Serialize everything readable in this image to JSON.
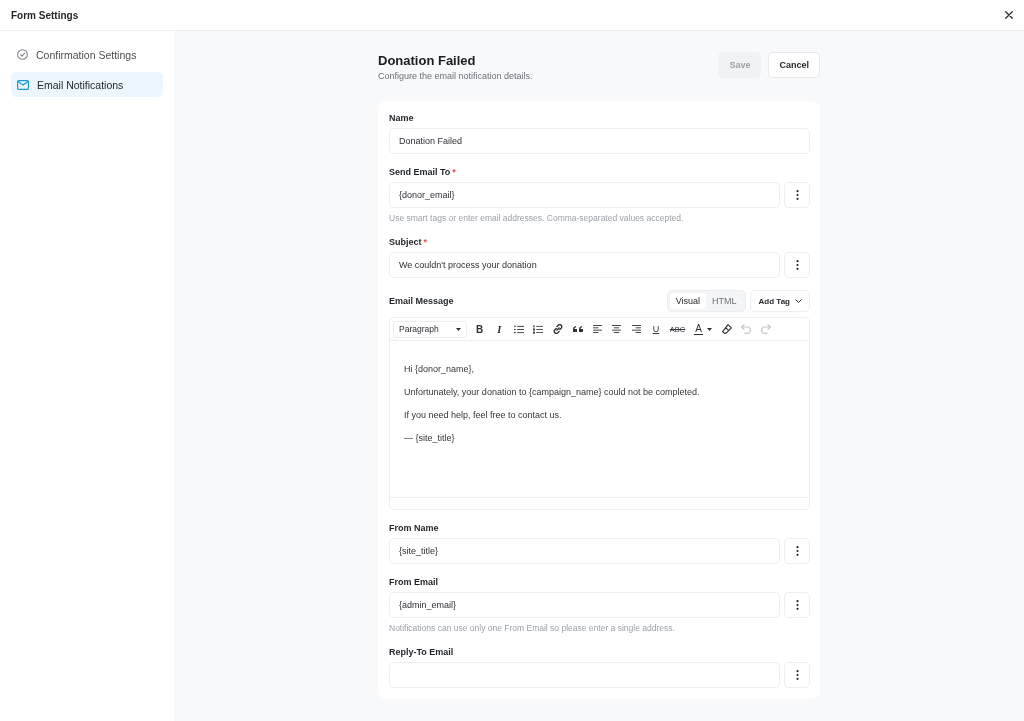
{
  "window": {
    "title": "Form Settings"
  },
  "sidebar": {
    "items": [
      {
        "kind": "check",
        "label": "Confirmation Settings",
        "selected": false
      },
      {
        "kind": "mail",
        "label": "Email Notifications",
        "selected": true
      }
    ]
  },
  "notification": {
    "title": "Donation Failed",
    "subtitle": "Configure the email notification details.",
    "buttons": [
      {
        "kind": "primary",
        "label": "Save",
        "disabled": true
      },
      {
        "kind": "secondary",
        "label": "Cancel",
        "disabled": false
      }
    ]
  },
  "form": {
    "fields": [
      {
        "kind": "text",
        "label": "Name",
        "value": "Donation Failed"
      },
      {
        "kind": "smart",
        "label": "Send Email To",
        "required_mark": "*",
        "value": "{donor_email}",
        "help": "Use smart tags or enter email addresses. Comma-separated values accepted."
      },
      {
        "kind": "smart",
        "label": "Subject",
        "required_mark": "*",
        "value": "We couldn't process your donation"
      },
      {
        "kind": "editor",
        "label": "Email Message",
        "modes": [
          {
            "label": "Visual",
            "selected": true
          },
          {
            "label": "HTML",
            "selected": false
          }
        ],
        "add_tag": "Add Tag",
        "toolbar": [
          {
            "kind": "format",
            "label": "Paragraph",
            "disabled": false
          },
          {
            "kind": "bold",
            "glyph": "B",
            "disabled": false
          },
          {
            "kind": "italic",
            "glyph": "I",
            "disabled": false
          },
          {
            "kind": "bullets",
            "disabled": false
          },
          {
            "kind": "numbers",
            "disabled": false
          },
          {
            "kind": "link",
            "disabled": false
          },
          {
            "kind": "quote",
            "disabled": false
          },
          {
            "kind": "align-left",
            "disabled": false
          },
          {
            "kind": "align-center",
            "disabled": false
          },
          {
            "kind": "align-right",
            "disabled": false
          },
          {
            "kind": "underline",
            "glyph": "U",
            "disabled": false
          },
          {
            "kind": "strike",
            "glyph": "ABC",
            "disabled": false
          },
          {
            "kind": "text-color",
            "glyph": "A",
            "disabled": false
          },
          {
            "kind": "eraser",
            "disabled": false
          },
          {
            "kind": "undo",
            "disabled": true
          },
          {
            "kind": "redo",
            "disabled": true
          }
        ],
        "paragraphs": [
          "Hi {donor_name},",
          "Unfortunately, your donation to {campaign_name} could not be completed.",
          "If you need help, feel free to contact us.",
          "— {site_title}"
        ]
      },
      {
        "kind": "smart",
        "label": "From Name",
        "value": "{site_title}"
      },
      {
        "kind": "smart",
        "label": "From Email",
        "value": "{admin_email}",
        "help": "Notifications can use only one From Email so please enter a single address."
      },
      {
        "kind": "smart",
        "label": "Reply-To Email"
      }
    ]
  }
}
